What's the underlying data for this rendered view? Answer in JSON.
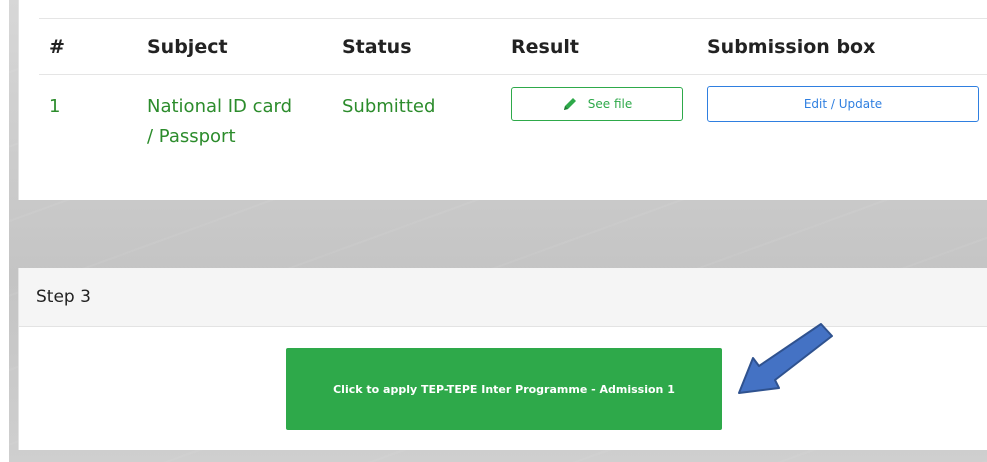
{
  "table": {
    "headers": [
      "#",
      "Subject",
      "Status",
      "Result",
      "Submission box"
    ],
    "rows": [
      {
        "number": "1",
        "subject_line1": "National ID card",
        "subject_line2": "/ Passport",
        "status": "Submitted",
        "result_button": "See file",
        "submission_button": "Edit / Update"
      }
    ]
  },
  "step3": {
    "title": "Step 3",
    "apply_button": "Click to apply TEP-TEPE Inter Programme - Admission 1"
  },
  "colors": {
    "green": "#2ea94a",
    "status_text": "#2c8c2c",
    "blue": "#2f7fe0",
    "arrow": "#4472c4"
  },
  "icons": {
    "result_icon": "pencil-icon",
    "annotation": "arrow-icon"
  }
}
